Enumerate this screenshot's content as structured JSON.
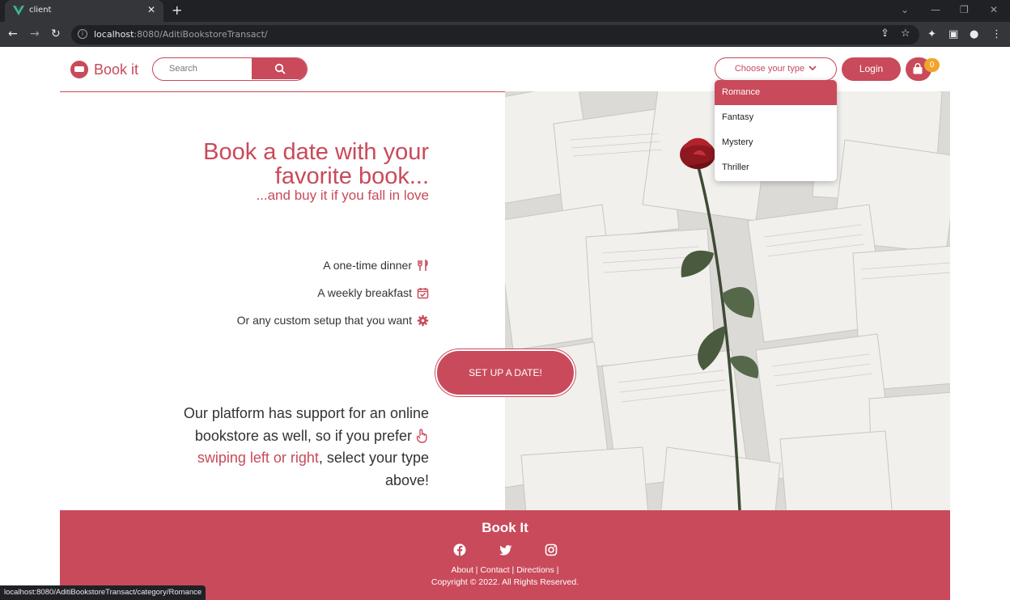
{
  "browser": {
    "tab_title": "client",
    "url_host": "localhost",
    "url_rest": ":8080/AditiBookstoreTransact/",
    "status_url": "localhost:8080/AditiBookstoreTransact/category/Romance"
  },
  "header": {
    "brand": "Book it",
    "search_placeholder": "Search",
    "choose_label": "Choose your type",
    "login_label": "Login",
    "cart_count": "0"
  },
  "dropdown": {
    "items": [
      "Romance",
      "Fantasy",
      "Mystery",
      "Thriller"
    ],
    "active": "Romance"
  },
  "hero": {
    "title_line1": "Book a date with your",
    "title_line2": "favorite book...",
    "subtitle": "...and buy it if you fall in love",
    "features": [
      "A one-time dinner",
      "A weekly breakfast",
      "Or any custom setup that you want"
    ],
    "cta_label": "SET UP A DATE!",
    "promo_part1": "Our platform has support for an online bookstore as well, so if you prefer",
    "promo_link": "swiping left or right",
    "promo_part2": ", select your type above!"
  },
  "footer": {
    "title": "Book It",
    "links": "About | Contact | Directions |",
    "copyright": "Copyright © 2022. All Rights Reserved."
  },
  "colors": {
    "accent": "#c94a5a",
    "badge": "#f0a52a"
  }
}
